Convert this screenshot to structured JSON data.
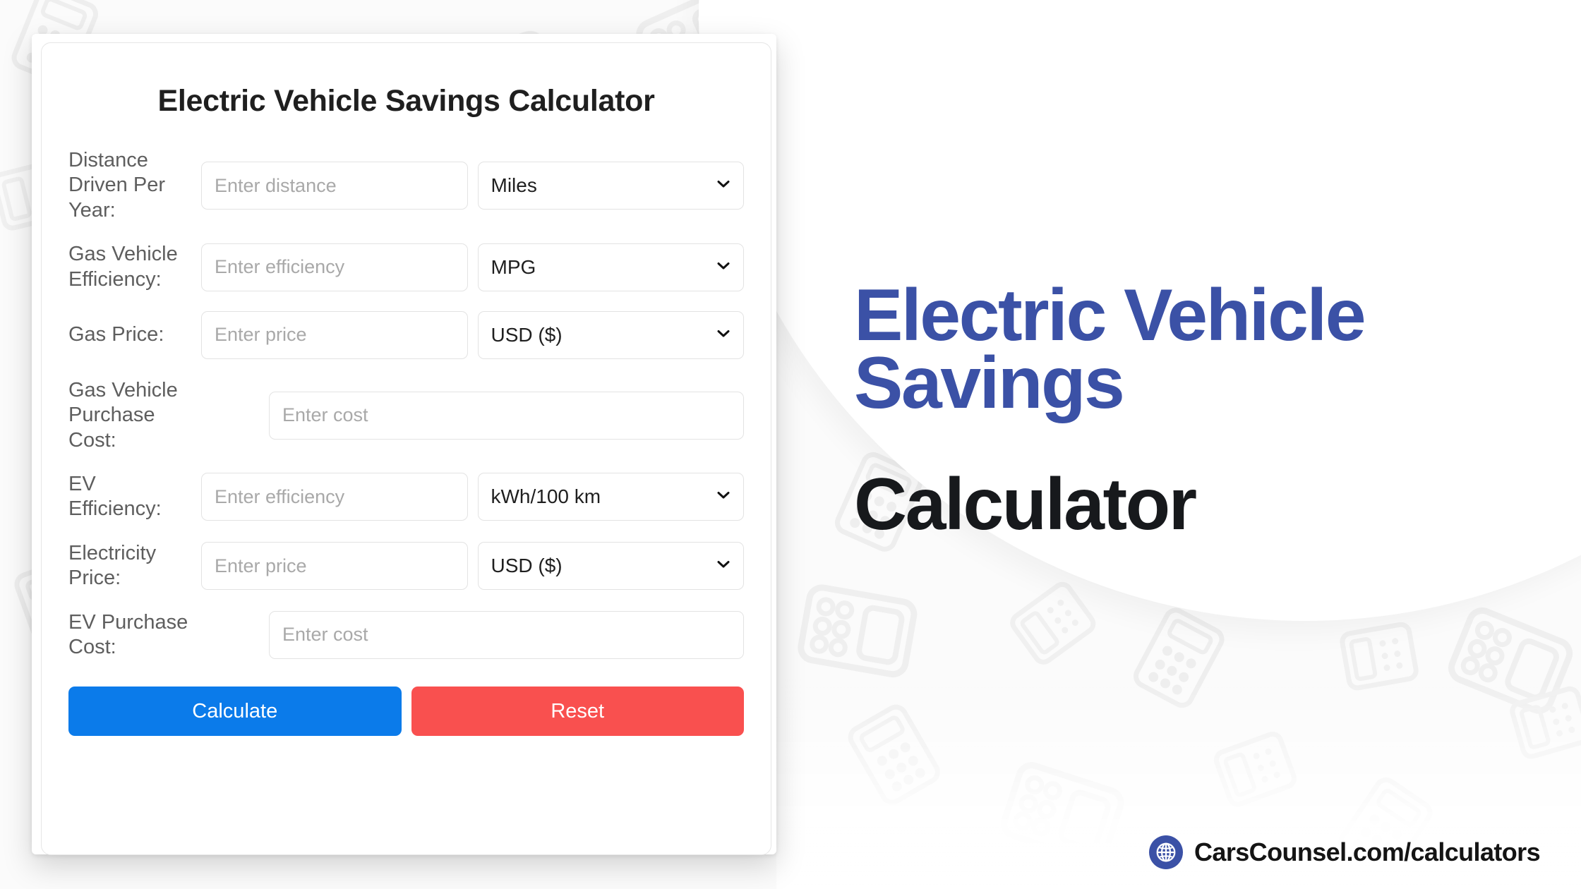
{
  "card": {
    "title": "Electric Vehicle Savings Calculator",
    "rows": [
      {
        "label": "Distance Driven Per Year:",
        "input_placeholder": "Enter distance",
        "unit_value": "Miles",
        "has_unit": true
      },
      {
        "label": "Gas Vehicle Efficiency:",
        "input_placeholder": "Enter efficiency",
        "unit_value": "MPG",
        "has_unit": true
      },
      {
        "label": "Gas Price:",
        "input_placeholder": "Enter price",
        "unit_value": "USD ($)",
        "has_unit": true
      },
      {
        "label": "Gas Vehicle Purchase Cost:",
        "input_placeholder": "Enter cost",
        "unit_value": "",
        "has_unit": false
      },
      {
        "label": "EV Efficiency:",
        "input_placeholder": "Enter efficiency",
        "unit_value": "kWh/100 km",
        "has_unit": true
      },
      {
        "label": "Electricity Price:",
        "input_placeholder": "Enter price",
        "unit_value": "USD ($)",
        "has_unit": true
      },
      {
        "label": "EV Purchase Cost:",
        "input_placeholder": "Enter cost",
        "unit_value": "",
        "has_unit": false
      }
    ],
    "buttons": {
      "calculate_label": "Calculate",
      "reset_label": "Reset",
      "calculate_color": "#0b7bea",
      "reset_color": "#f9504f"
    }
  },
  "hero": {
    "line_a": "Electric Vehicle",
    "line_b": "Savings",
    "line_c": "Calculator",
    "accent_color": "#3b51a6",
    "dark_color": "#17191c"
  },
  "footer": {
    "brand_text": "CarsCounsel.com/calculators",
    "icon": "globe-icon",
    "icon_bg": "#3b51a6"
  }
}
